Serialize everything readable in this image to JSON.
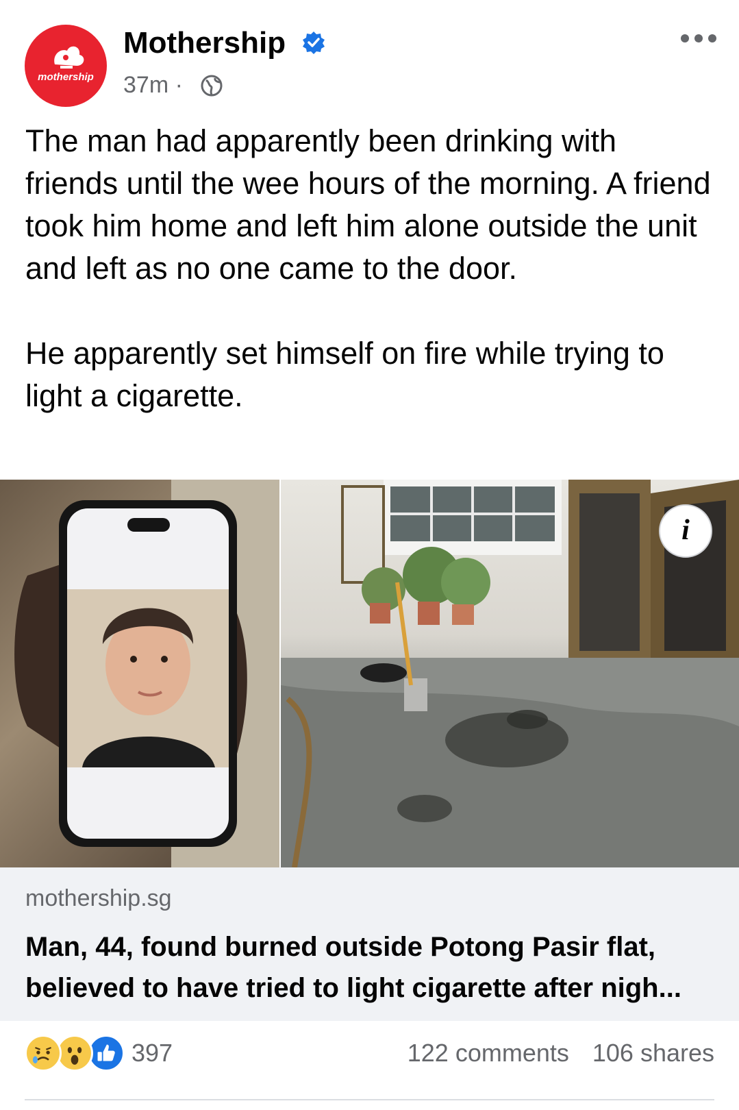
{
  "post": {
    "page_name": "Mothership",
    "avatar_text": "mothership",
    "time": "37m",
    "separator": "·",
    "audience_icon": "globe-icon",
    "verified_icon": "verified-badge-icon",
    "more_icon": "more-options-icon",
    "paragraphs": [
      "The man had apparently been drinking with friends until the wee hours of the morning. A friend took him home and left him alone outside the unit and left as no one came to the door.",
      "He apparently set himself on fire while trying to light a cigarette."
    ]
  },
  "link": {
    "domain": "mothership.sg",
    "title": "Man, 44, found burned outside Potong Pasir flat, believed to have tried to light cigarette after nigh..."
  },
  "footer": {
    "reaction_icons": [
      "sad-reaction-icon",
      "wow-reaction-icon",
      "like-reaction-icon"
    ],
    "reaction_count": "397",
    "comments": "122 comments",
    "shares": "106 shares"
  },
  "colors": {
    "brand_red": "#e8232f",
    "verified_blue": "#1b74e4",
    "secondary_text": "#65676b",
    "link_card_bg": "#f0f2f5"
  }
}
